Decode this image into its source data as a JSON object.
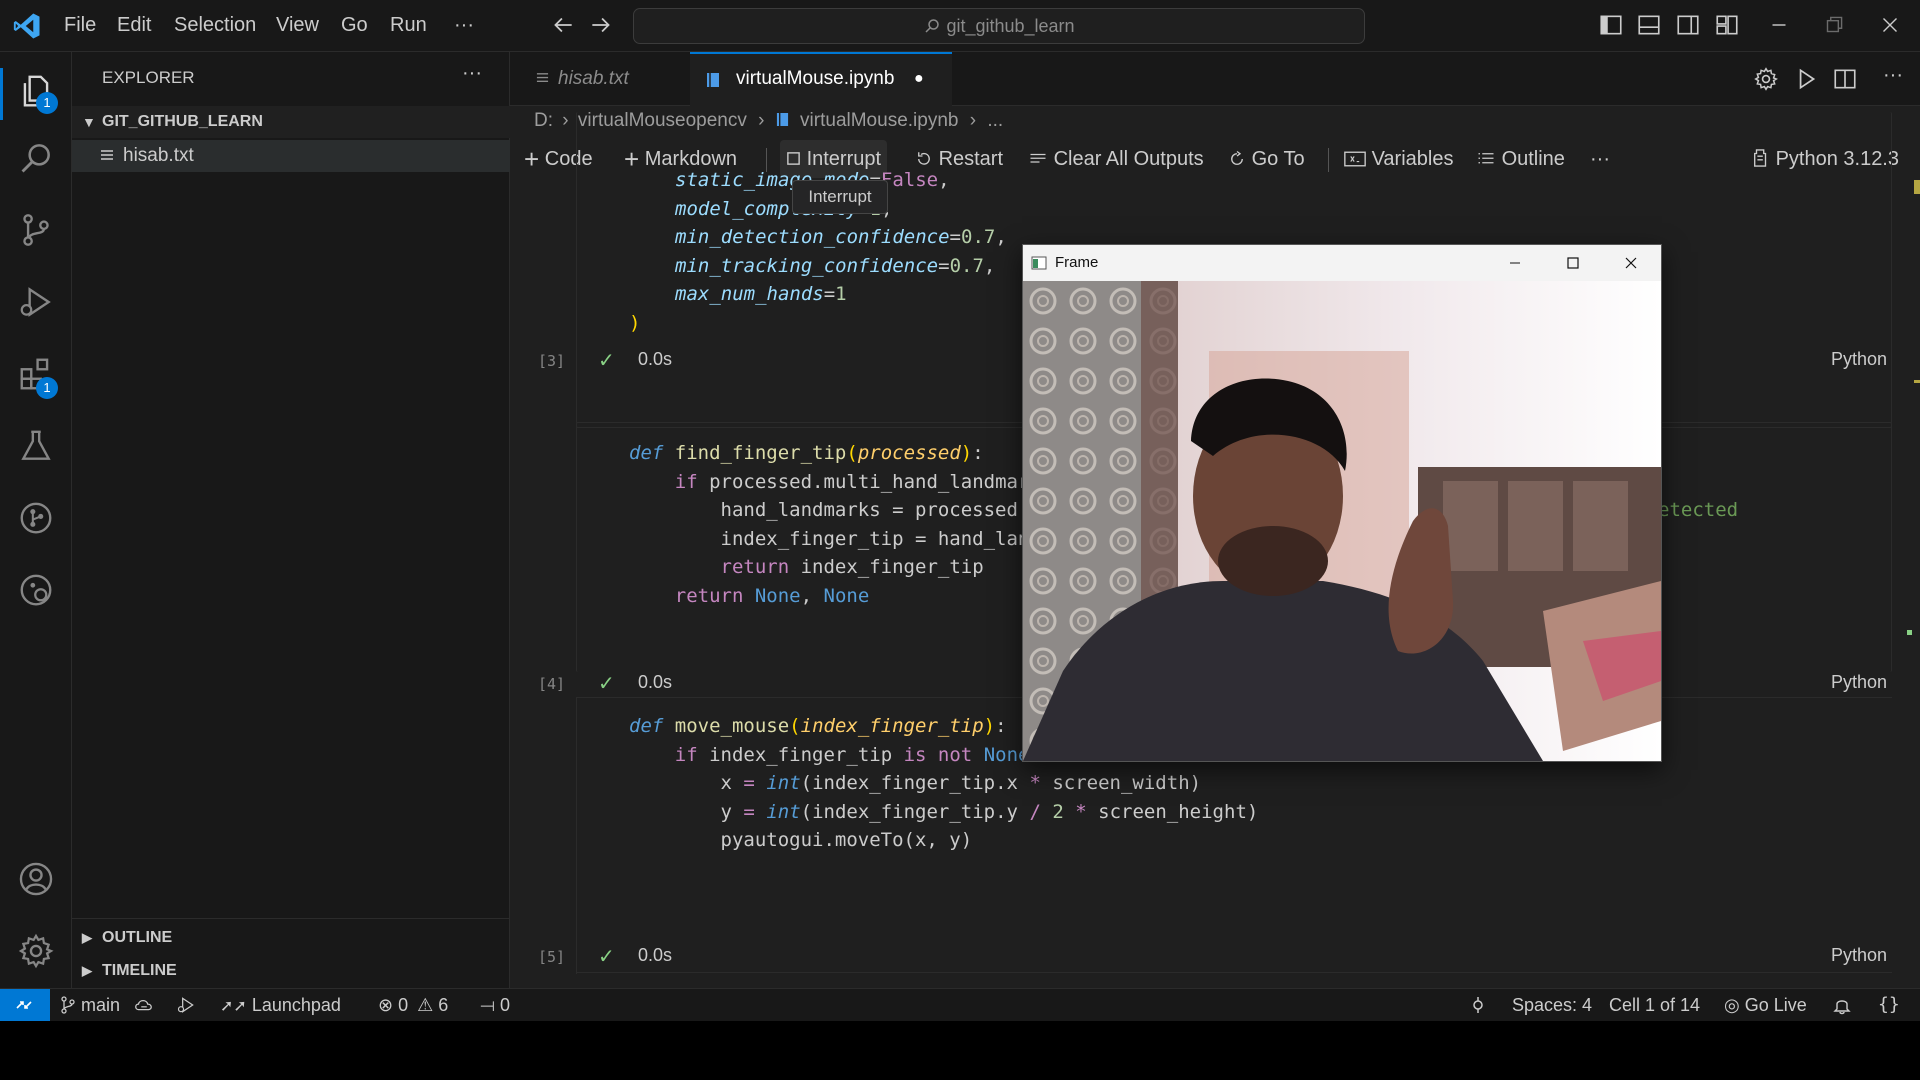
{
  "titlebar": {
    "menu": [
      "File",
      "Edit",
      "Selection",
      "View",
      "Go",
      "Run",
      "···"
    ],
    "search_text": "git_github_learn"
  },
  "activity": {
    "explorer_badge": "1",
    "extensions_badge": "1"
  },
  "sidebar": {
    "title": "EXPLORER",
    "more": "···",
    "folder": "GIT_GITHUB_LEARN",
    "files": [
      "hisab.txt"
    ],
    "outline": "OUTLINE",
    "timeline": "TIMELINE"
  },
  "tabs": [
    {
      "label": "hisab.txt"
    },
    {
      "label": "virtualMouse.ipynb",
      "dirty": "●"
    }
  ],
  "breadcrumb": {
    "drive": "D:",
    "folder": "virtualMouseopencv",
    "file": "virtualMouse.ipynb",
    "more": "..."
  },
  "notebook_toolbar": {
    "code": "Code",
    "markdown": "Markdown",
    "interrupt": "Interrupt",
    "restart": "Restart",
    "clear": "Clear All Outputs",
    "goto": "Go To",
    "variables": "Variables",
    "outline": "Outline",
    "more": "···",
    "kernel": "Python 3.12.3"
  },
  "tooltip": "Interrupt",
  "cells": [
    {
      "exec": "[3]",
      "time": "0.0s",
      "lang": "Python"
    },
    {
      "exec": "[4]",
      "time": "0.0s",
      "lang": "Python"
    },
    {
      "exec": "[5]",
      "time": "0.0s",
      "lang": "Python"
    }
  ],
  "overflow_text": "etected",
  "frame_window": {
    "title": "Frame"
  },
  "status": {
    "branch": "main",
    "launchpad": "Launchpad",
    "errors": "0",
    "warnings": "6",
    "ports": "0",
    "spaces": "Spaces: 4",
    "cell": "Cell 1 of 14",
    "golive": "Go Live"
  },
  "colors": {
    "accent": "#0078d4",
    "background": "#1f1f1f",
    "check": "#89d185"
  }
}
